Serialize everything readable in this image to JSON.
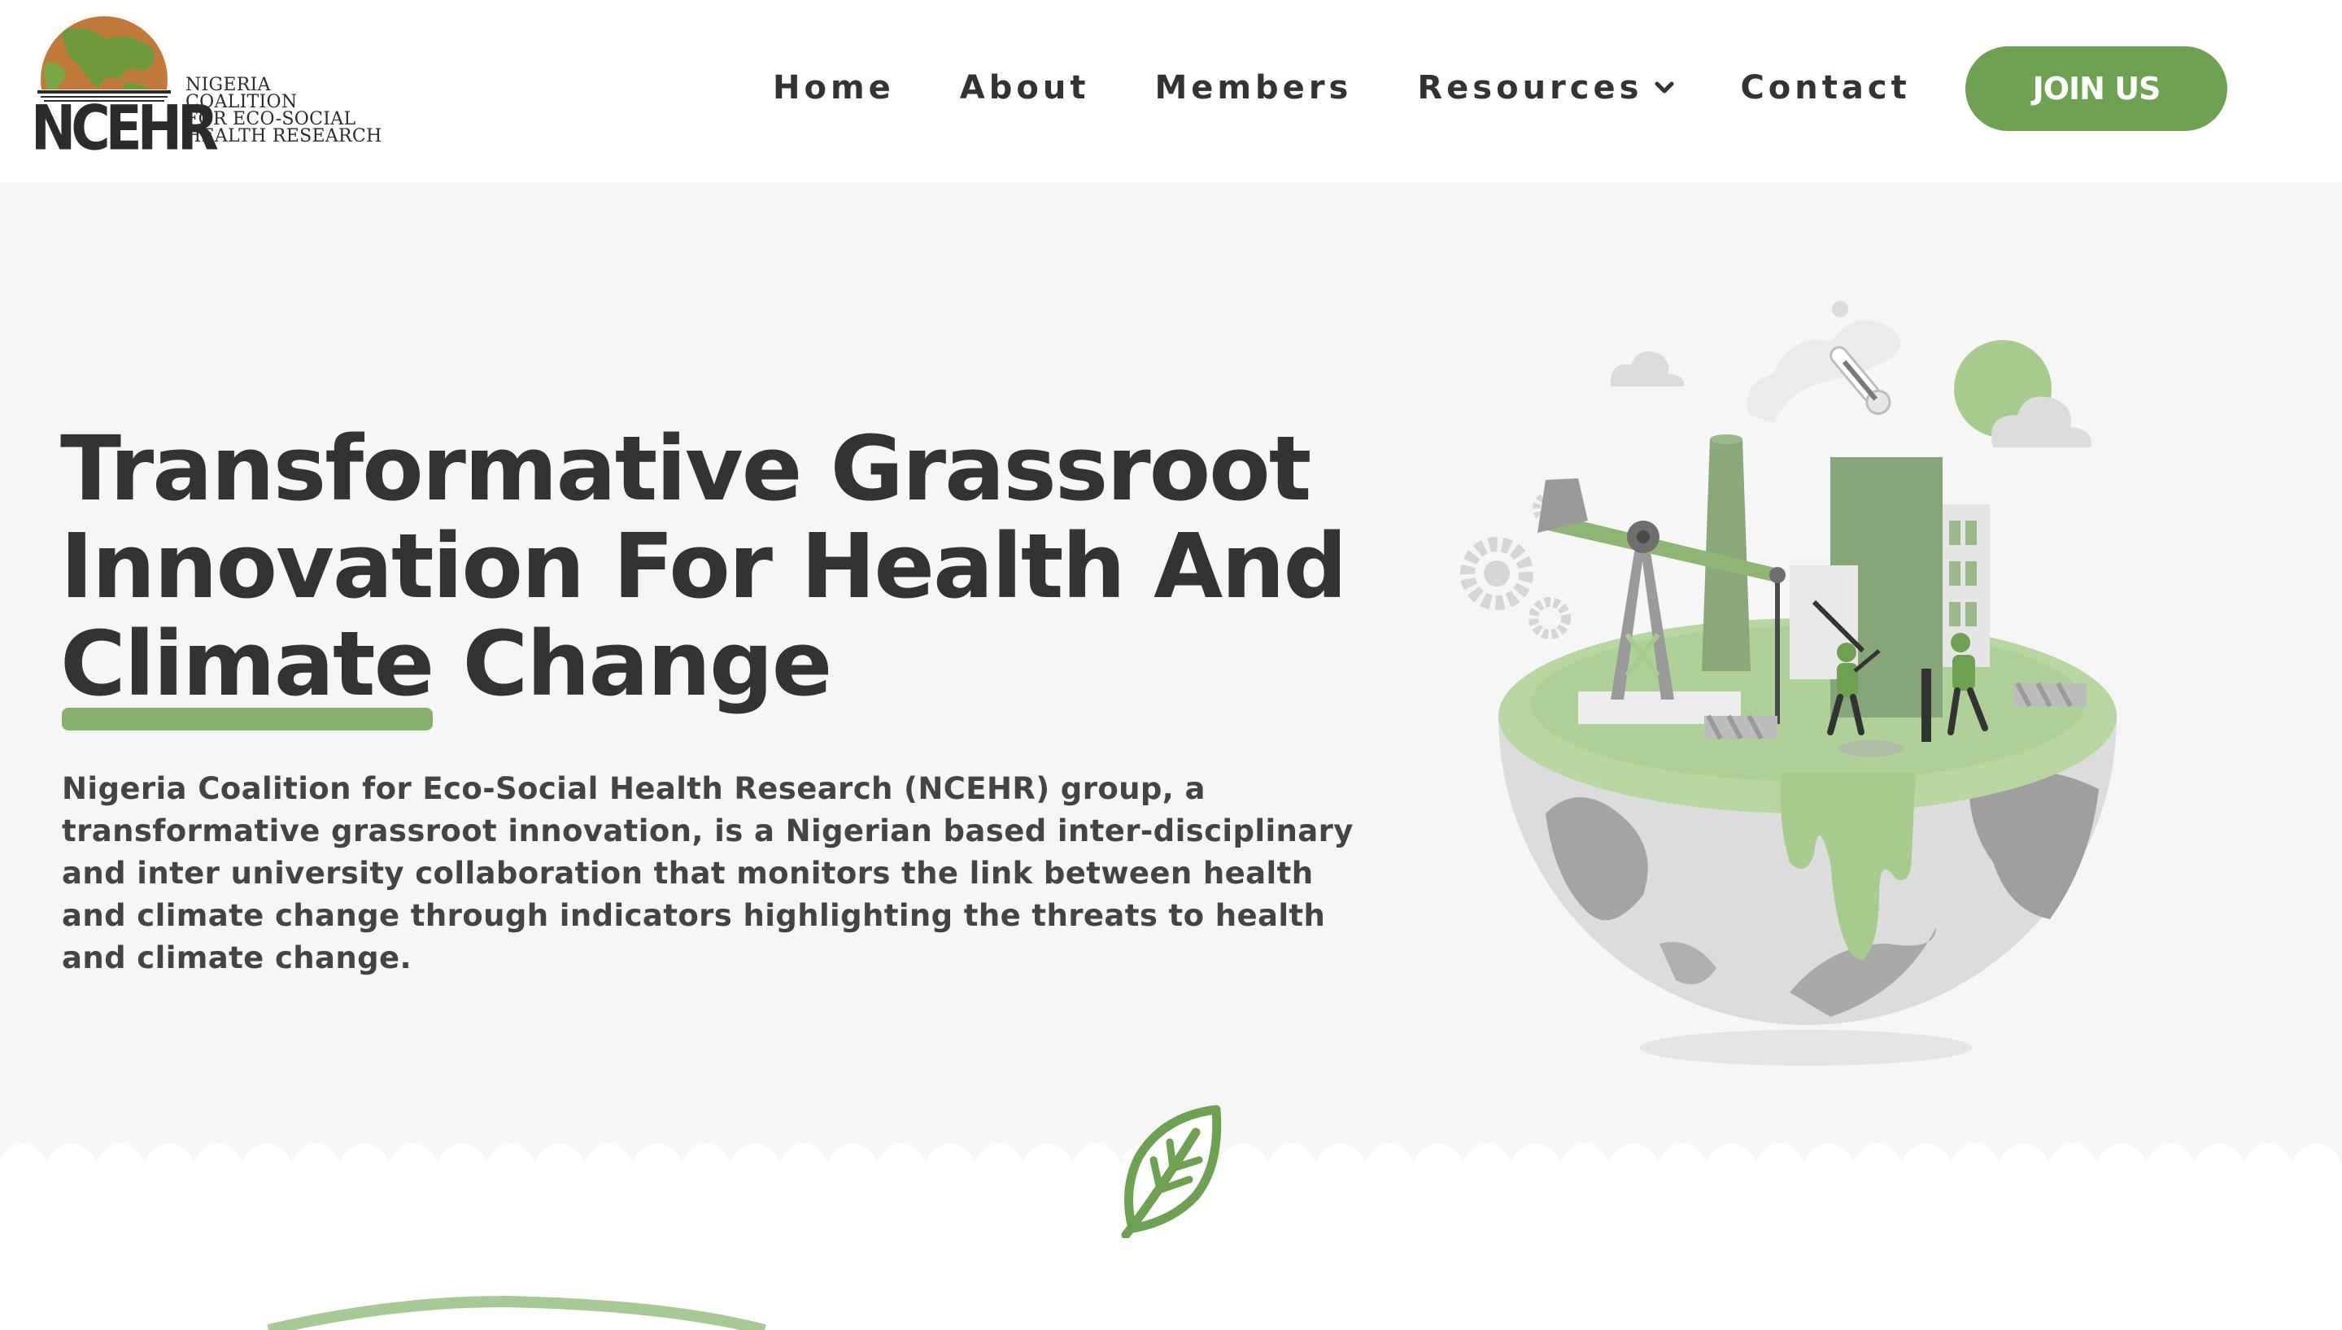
{
  "brand": {
    "abbr": "NCEHR",
    "name_lines": [
      "NIGERIA",
      "COALITION",
      "FOR ECO-SOCIAL",
      "HEALTH RESEARCH"
    ],
    "icon": "globe-book-logo"
  },
  "nav": {
    "items": [
      {
        "label": "Home"
      },
      {
        "label": "About"
      },
      {
        "label": "Members"
      },
      {
        "label": "Resources",
        "icon": "chevron-down-icon"
      },
      {
        "label": "Contact"
      }
    ],
    "cta": "JOIN US"
  },
  "hero": {
    "title_line1": "Transformative Grassroot",
    "title_line2": "Innovation For Health And",
    "title_line3_underlined": "Climate",
    "title_line3_rest": "Change",
    "description": "Nigeria Coalition for Eco-Social Health Research (NCEHR) group, a transformative grassroot innovation, is a Nigerian based inter-disciplinary and inter university collaboration that monitors the link between health and climate change through indicators highlighting the threats to health and climate change."
  },
  "colors": {
    "accent": "#6ea152",
    "underline": "#86b06c",
    "text": "#333333",
    "background": "#f6f6f6",
    "header_bg": "#ffffff"
  },
  "decor": {
    "illustration": "half-earth-industry-illustration",
    "divider_icon": "leaf-icon"
  }
}
